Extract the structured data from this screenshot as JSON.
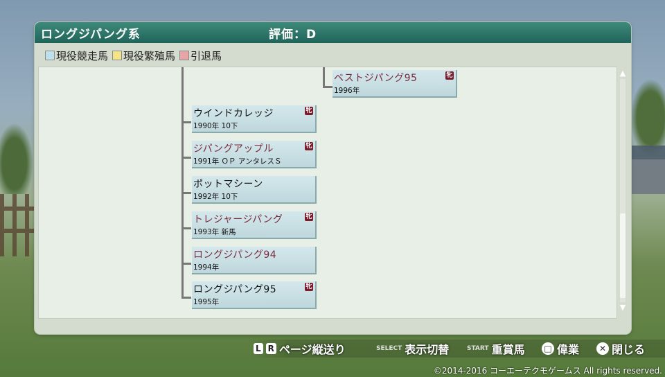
{
  "header": {
    "title": "ロングジパング系",
    "rating": "評価：D"
  },
  "legend": [
    {
      "label": "現役競走馬",
      "color": "#bfe0ea"
    },
    {
      "label": "現役繁殖馬",
      "color": "#f3e48a"
    },
    {
      "label": "引退馬",
      "color": "#e6a6a8"
    }
  ],
  "horses": [
    {
      "name": "ベストジパング95",
      "info": "1996年",
      "mark": "牝",
      "retired": true
    },
    {
      "name": "ウインドカレッジ",
      "info": "1990年 10下",
      "mark": "牝",
      "retired": false
    },
    {
      "name": "ジパングアップル",
      "info": "1991年 ＯＰ アンタレスＳ",
      "mark": "牝",
      "retired": true
    },
    {
      "name": "ポットマシーン",
      "info": "1992年 10下",
      "mark": "",
      "retired": false
    },
    {
      "name": "トレジャージパング",
      "info": "1993年 新馬",
      "mark": "牝",
      "retired": true
    },
    {
      "name": "ロングジパング94",
      "info": "1994年",
      "mark": "",
      "retired": true
    },
    {
      "name": "ロングジパング95",
      "info": "1995年",
      "mark": "牝",
      "retired": false
    }
  ],
  "controls": [
    {
      "keys": [
        "L",
        "R"
      ],
      "label": "ページ縦送り"
    },
    {
      "keys": [
        "SELECT"
      ],
      "label": "表示切替"
    },
    {
      "keys": [
        "START"
      ],
      "label": "重賞馬"
    },
    {
      "keys": [
        "□"
      ],
      "label": "偉業"
    },
    {
      "keys": [
        "✕"
      ],
      "label": "閉じる"
    }
  ],
  "copyright": "©2014-2016 コーエーテクモゲームス All rights reserved."
}
